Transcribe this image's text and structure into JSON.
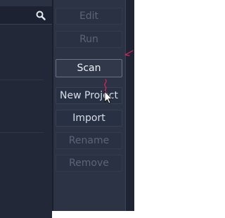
{
  "project_manager": {
    "search": {
      "icon": "search-icon"
    },
    "actions": [
      {
        "label": "Edit",
        "enabled": false
      },
      {
        "label": "Run",
        "enabled": false
      },
      {
        "label": "Scan",
        "enabled": true
      },
      {
        "label": "New Project",
        "enabled": true
      },
      {
        "label": "Import",
        "enabled": true
      },
      {
        "label": "Rename",
        "enabled": false
      },
      {
        "label": "Remove",
        "enabled": false
      }
    ]
  },
  "colors": {
    "background": "#2a3142",
    "button_text": "#d8dde6",
    "disabled_text": "#5c6478",
    "annotation": "#e0245e"
  }
}
